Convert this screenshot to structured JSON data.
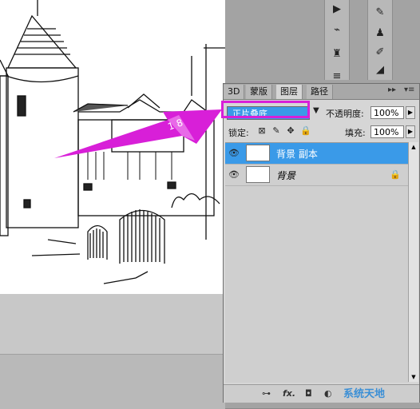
{
  "panel": {
    "tabs": [
      "3D",
      "蒙版",
      "图层",
      "路径"
    ],
    "active_tab": "图层",
    "blend_mode": "正片叠底",
    "opacity_label": "不透明度:",
    "opacity_value": "100%",
    "lock_label": "锁定:",
    "fill_label": "填充:",
    "fill_value": "100%",
    "layers": [
      {
        "name": "背景 副本",
        "selected": true
      },
      {
        "name": "背景",
        "selected": false,
        "locked": true
      }
    ]
  },
  "annotation": {
    "accent_color": "#d81fd8"
  },
  "watermark": {
    "text": "系统天地"
  },
  "colors": {
    "selection": "#3a9ae8",
    "panel_bg": "#d6d6d6"
  }
}
